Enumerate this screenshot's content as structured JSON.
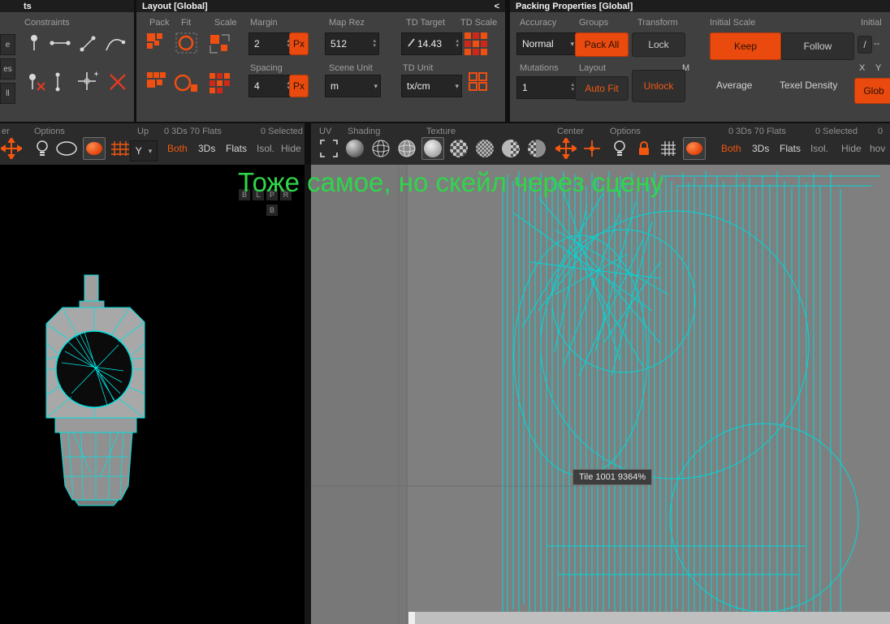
{
  "colors": {
    "accent": "#ee4c0e",
    "wireframe": "#00e0e0",
    "overlay_green": "#2fd64a",
    "viewport_gray": "#7f7f7f"
  },
  "icons": {
    "chevron_down": "▾",
    "spinner_up": "▴",
    "spinner_down": "▾",
    "collapse_left": "<"
  },
  "constraints_panel": {
    "title_fragment": "ts",
    "label": "Constraints",
    "edge_buttons": [
      "e",
      "es",
      "ll"
    ]
  },
  "layout_panel": {
    "title": "Layout [Global]",
    "pack_label": "Pack",
    "fit_label": "Fit",
    "scale_label": "Scale",
    "margin_label": "Margin",
    "margin_value": "2",
    "margin_unit": "Px",
    "spacing_label": "Spacing",
    "spacing_value": "4",
    "spacing_unit": "Px",
    "map_rez_label": "Map Rez",
    "map_rez_value": "512",
    "scene_unit_label": "Scene Unit",
    "scene_unit_value": "m",
    "td_target_label": "TD Target",
    "td_target_value": "14.43",
    "td_unit_label": "TD Unit",
    "td_unit_value": "tx/cm",
    "td_scale_label": "TD Scale"
  },
  "packing_panel": {
    "title": "Packing Properties [Global]",
    "accuracy_label": "Accuracy",
    "accuracy_value": "Normal",
    "groups_label": "Groups",
    "pack_all_button": "Pack All",
    "transform_label": "Transform",
    "lock_button": "Lock",
    "m_label": "M",
    "initial_scale_label": "Initial Scale",
    "keep_button": "Keep",
    "follow_button": "Follow",
    "mutations_label": "Mutations",
    "mutations_value": "1",
    "layout_label": "Layout",
    "auto_fit_button": "Auto Fit",
    "unlock_button": "Unlock",
    "average_label": "Average",
    "texel_density_label": "Texel Density",
    "initial_label": "Initial",
    "slash_button": "/",
    "dash_value": "--",
    "x_label": "X",
    "y_label": "Y",
    "glob_button": "Glob"
  },
  "left_toolbar": {
    "title_fragment": "er",
    "options_label": "Options",
    "up_label": "Up",
    "stats": "0 3Ds 70 Flats",
    "selected_stats": "0 Selected",
    "axis_value": "Y",
    "both_label": "Both",
    "threeds_label": "3Ds",
    "flats_label": "Flats",
    "isol_label": "Isol.",
    "hide_label": "Hide"
  },
  "right_toolbar": {
    "uv_label": "UV",
    "shading_label": "Shading",
    "texture_label": "Texture",
    "center_label": "Center",
    "options_label": "Options",
    "stats": "0 3Ds 70 Flats",
    "selected_stats": "0 Selected",
    "extra_stat": "0",
    "both_label": "Both",
    "threeds_label": "3Ds",
    "flats_label": "Flats",
    "isol_label": "Isol.",
    "hide_label": "Hide",
    "hover_fragment": "hov"
  },
  "viewport": {
    "overlay_text": "Тоже самое, но скейл через сцену",
    "tooltip": "Tile 1001 9364%",
    "axis_letters": [
      "B",
      "L",
      "P",
      "R"
    ],
    "axis_letter_extra": "B"
  }
}
